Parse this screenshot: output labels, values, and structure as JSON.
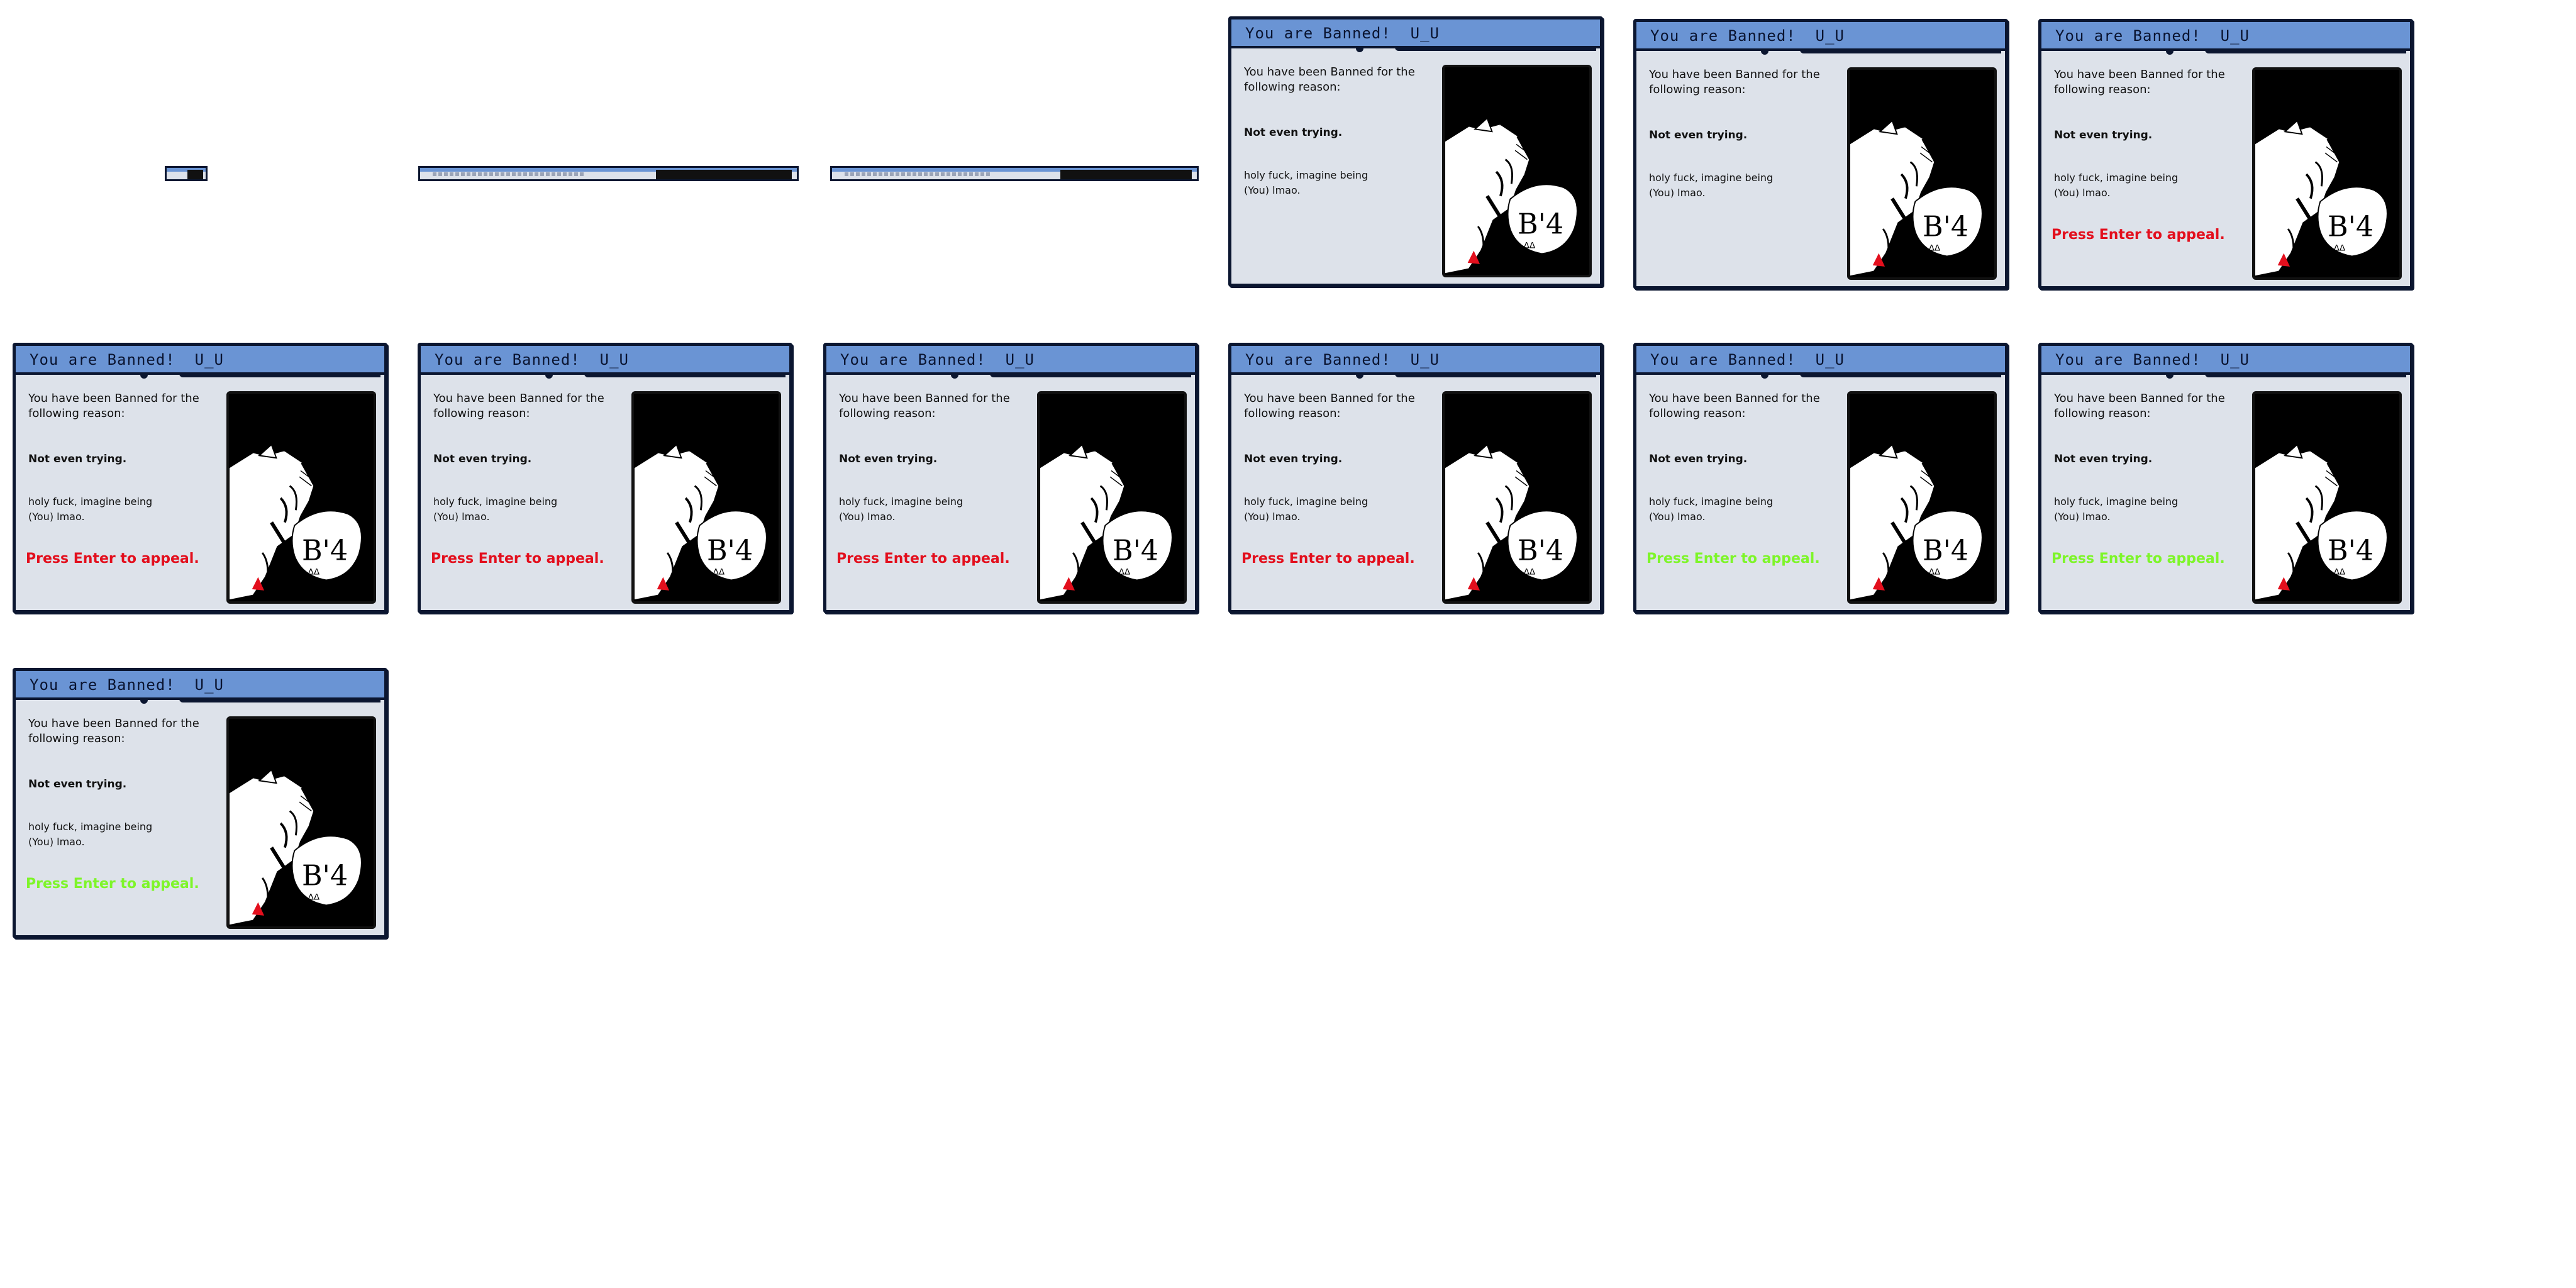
{
  "dialog": {
    "title": "You are Banned!  U_U",
    "intro": "You have been Banned for the following reason:",
    "reason": "Not even trying.",
    "comment": "holy fuck, imagine being (You) lmao.",
    "appeal": "Press Enter to appeal.",
    "art_caption": "B'4"
  },
  "colors": {
    "appeal_red": "#e30f1d",
    "appeal_green": "#7ef52a",
    "title_blue": "#6a94d4",
    "panel_bg": "#dde2ea",
    "border": "#0b1630"
  },
  "frames": [
    {
      "kind": "mini",
      "state": "opening"
    },
    {
      "kind": "mini",
      "state": "opening"
    },
    {
      "kind": "mini",
      "state": "opening"
    },
    {
      "kind": "dialog",
      "appeal_state": "none"
    },
    {
      "kind": "dialog",
      "appeal_state": "none"
    },
    {
      "kind": "dialog",
      "appeal_state": "red"
    },
    {
      "kind": "dialog",
      "appeal_state": "red"
    },
    {
      "kind": "dialog",
      "appeal_state": "red"
    },
    {
      "kind": "dialog",
      "appeal_state": "red"
    },
    {
      "kind": "dialog",
      "appeal_state": "red"
    },
    {
      "kind": "dialog",
      "appeal_state": "green"
    },
    {
      "kind": "dialog",
      "appeal_state": "green"
    },
    {
      "kind": "dialog",
      "appeal_state": "green"
    }
  ]
}
